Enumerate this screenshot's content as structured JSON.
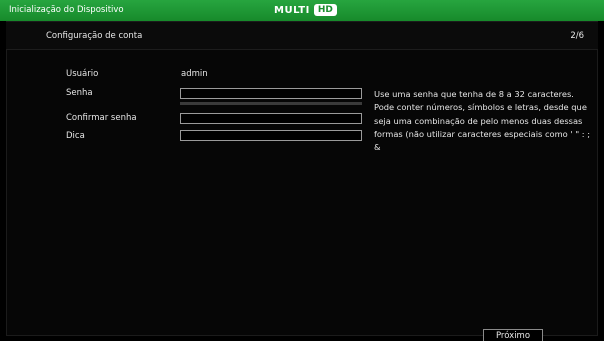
{
  "window": {
    "title": "Inicialização do Dispositivo",
    "logo_text": "MULTI",
    "logo_badge": "HD"
  },
  "header": {
    "section_title": "Configuração de conta",
    "step": "2/6"
  },
  "form": {
    "user_label": "Usuário",
    "user_value": "admin",
    "password_label": "Senha",
    "password_value": "",
    "confirm_label": "Confirmar senha",
    "confirm_value": "",
    "hint_label": "Dica",
    "hint_value": ""
  },
  "help_text": "Use uma senha que tenha de 8 a 32 caracteres. Pode conter números, símbolos e letras, desde que seja uma combinação de pelo menos duas dessas formas (não utilizar caracteres especiais como ' \" : ; &",
  "footer": {
    "next_label": "Próximo"
  },
  "colors": {
    "titlebar": "#1f9a36",
    "background": "#000000",
    "text": "#e6e6e6"
  }
}
